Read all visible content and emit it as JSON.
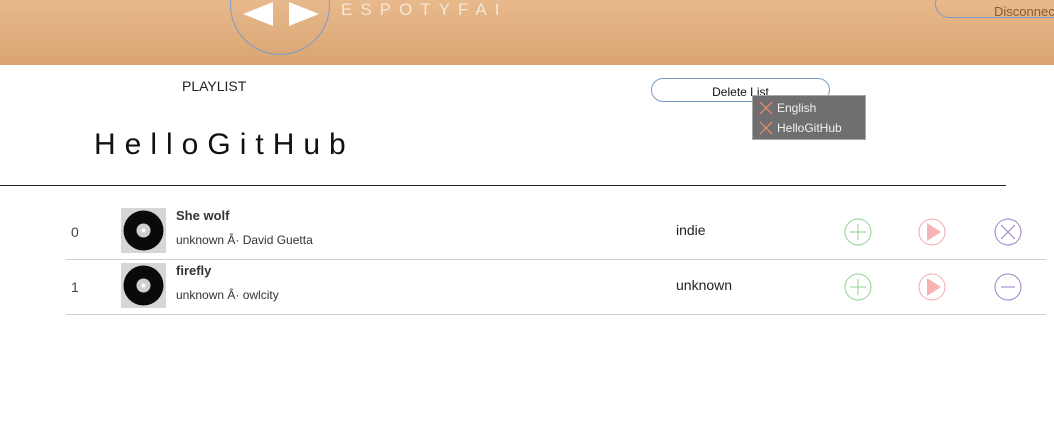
{
  "header": {
    "brand": "ESPOTYFAI",
    "disconnect_label": "Disconnect"
  },
  "playlist": {
    "section_label": "PLAYLIST",
    "title": "HelloGitHub",
    "delete_label": "Delete List",
    "dropdown": [
      "English",
      "HelloGitHub"
    ]
  },
  "tracks": [
    {
      "index": "0",
      "name": "She wolf",
      "meta": "unknown Â· David Guetta",
      "genre": "indie",
      "remove_icon": "close-circle-icon"
    },
    {
      "index": "1",
      "name": "firefly",
      "meta": "unknown Â· owlcity",
      "genre": "unknown",
      "remove_icon": "minus-circle-icon"
    }
  ],
  "colors": {
    "header_top": "#e8b98c",
    "header_bottom": "#d9a472",
    "add": "#8fd18f",
    "play": "#f4a9a9",
    "remove": "#9b7fc6",
    "outline": "#7a9cc4"
  }
}
